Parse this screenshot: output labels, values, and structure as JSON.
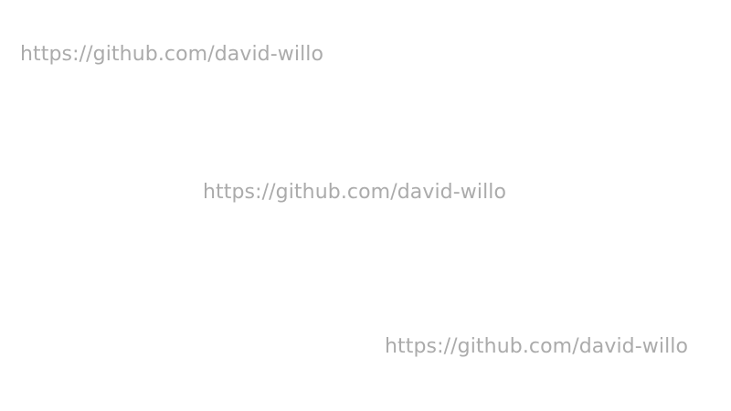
{
  "colors": {
    "background": "#ffffff",
    "watermark_text": "#ababab"
  },
  "watermarks": [
    {
      "text": "https://github.com/david-willo"
    },
    {
      "text": "https://github.com/david-willo"
    },
    {
      "text": "https://github.com/david-willo"
    }
  ]
}
